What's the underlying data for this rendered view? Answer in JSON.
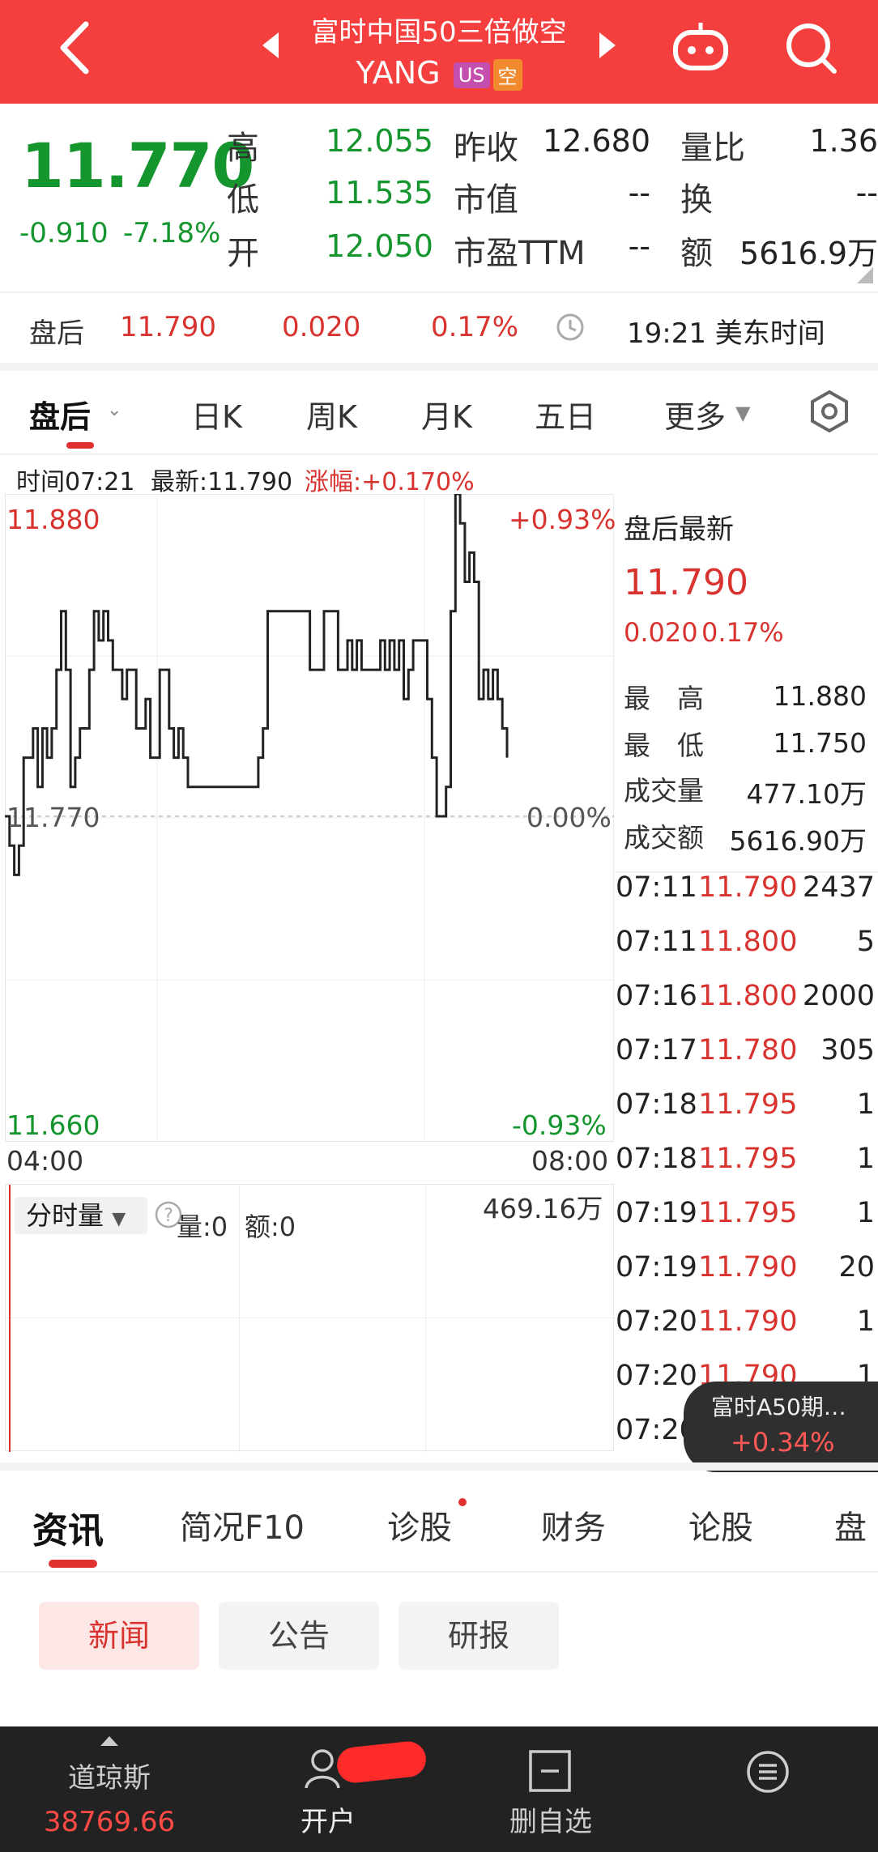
{
  "header": {
    "title": "富时中国50三倍做空",
    "ticker": "YANG",
    "badge_market": "US",
    "badge_type": "空",
    "bg_color": "#f43f3e"
  },
  "quote": {
    "price": "11.770",
    "change": "-0.910",
    "change_pct": "-7.18%",
    "rows": [
      {
        "l1": "高",
        "v1": "12.055",
        "l2": "昨收",
        "v2": "12.680",
        "l3": "量比",
        "v3": "1.36"
      },
      {
        "l1": "低",
        "v1": "11.535",
        "l2": "市值",
        "v2": "--",
        "l3": "换",
        "v3": "--"
      },
      {
        "l1": "开",
        "v1": "12.050",
        "l2": "市盈TTM",
        "v2": "--",
        "l3": "额",
        "v3": "5616.9万"
      }
    ]
  },
  "after_hours": {
    "label": "盘后",
    "price": "11.790",
    "change": "0.020",
    "pct": "0.17%",
    "time": "19:21 美东时间"
  },
  "chart_tabs": [
    "盘后",
    "日K",
    "周K",
    "月K",
    "五日",
    "更多"
  ],
  "chart_info": {
    "time": "时间07:21",
    "latest": "最新:11.790",
    "pct": "涨幅:+0.170%"
  },
  "chart_data": {
    "type": "line",
    "x_start": "04:00",
    "x_end": "08:00",
    "ylim": [
      11.66,
      11.88
    ],
    "y_top_label": "11.880",
    "y_mid_label": "11.770",
    "y_bottom_label": "11.660",
    "pct_top": "+0.93%",
    "pct_mid": "0.00%",
    "pct_bottom": "-0.93%",
    "values": [
      11.77,
      11.76,
      11.75,
      11.76,
      11.79,
      11.79,
      11.8,
      11.78,
      11.8,
      11.79,
      11.8,
      11.82,
      11.84,
      11.82,
      11.78,
      11.79,
      11.8,
      11.8,
      11.82,
      11.84,
      11.83,
      11.84,
      11.83,
      11.82,
      11.82,
      11.81,
      11.82,
      11.82,
      11.8,
      11.8,
      11.81,
      11.79,
      11.79,
      11.82,
      11.82,
      11.8,
      11.79,
      11.8,
      11.79,
      11.78,
      11.78,
      11.78,
      11.78,
      11.78,
      11.78,
      11.78,
      11.78,
      11.78,
      11.78,
      11.78,
      11.78,
      11.78,
      11.78,
      11.78,
      11.79,
      11.8,
      11.84,
      11.84,
      11.84,
      11.84,
      11.84,
      11.84,
      11.84,
      11.84,
      11.84,
      11.82,
      11.82,
      11.82,
      11.84,
      11.84,
      11.84,
      11.82,
      11.82,
      11.83,
      11.82,
      11.83,
      11.82,
      11.82,
      11.82,
      11.82,
      11.83,
      11.82,
      11.83,
      11.82,
      11.83,
      11.81,
      11.82,
      11.83,
      11.83,
      11.83,
      11.81,
      11.79,
      11.77,
      11.77,
      11.78,
      11.84,
      11.88,
      11.87,
      11.85,
      11.86,
      11.85,
      11.81,
      11.82,
      11.81,
      11.82,
      11.81,
      11.8,
      11.79
    ],
    "volume_max_label": "469.16万"
  },
  "volume_panel": {
    "dropdown": "分时量",
    "vol": "量:0",
    "amt": "额:0"
  },
  "side_panel": {
    "title": "盘后最新",
    "price": "11.790",
    "change": "0.020",
    "pct": "0.17%",
    "stats": [
      {
        "label": "最　高",
        "value": "11.880"
      },
      {
        "label": "最　低",
        "value": "11.750"
      },
      {
        "label": "成交量",
        "value": "477.10万"
      },
      {
        "label": "成交额",
        "value": "5616.90万"
      }
    ]
  },
  "trades": [
    {
      "time": "07:11",
      "price": "11.790",
      "vol": "2437"
    },
    {
      "time": "07:11",
      "price": "11.800",
      "vol": "5"
    },
    {
      "time": "07:16",
      "price": "11.800",
      "vol": "2000"
    },
    {
      "time": "07:17",
      "price": "11.780",
      "vol": "305"
    },
    {
      "time": "07:18",
      "price": "11.795",
      "vol": "1"
    },
    {
      "time": "07:18",
      "price": "11.795",
      "vol": "1"
    },
    {
      "time": "07:19",
      "price": "11.795",
      "vol": "1"
    },
    {
      "time": "07:19",
      "price": "11.790",
      "vol": "20"
    },
    {
      "time": "07:20",
      "price": "11.790",
      "vol": "1"
    },
    {
      "time": "07:20",
      "price": "11.790",
      "vol": "1"
    },
    {
      "time": "07:20",
      "price": "",
      "vol": ""
    }
  ],
  "float_widget": {
    "name": "富时A50期…",
    "pct": "+0.34%"
  },
  "info_tabs": [
    "资讯",
    "简况F10",
    "诊股",
    "财务",
    "论股",
    "盘"
  ],
  "news_pills": [
    "新闻",
    "公告",
    "研报"
  ],
  "bottom_bar": {
    "index_name": "道琼斯",
    "index_value": "38769.66",
    "open_account": "开户",
    "remove_watch": "删自选"
  }
}
